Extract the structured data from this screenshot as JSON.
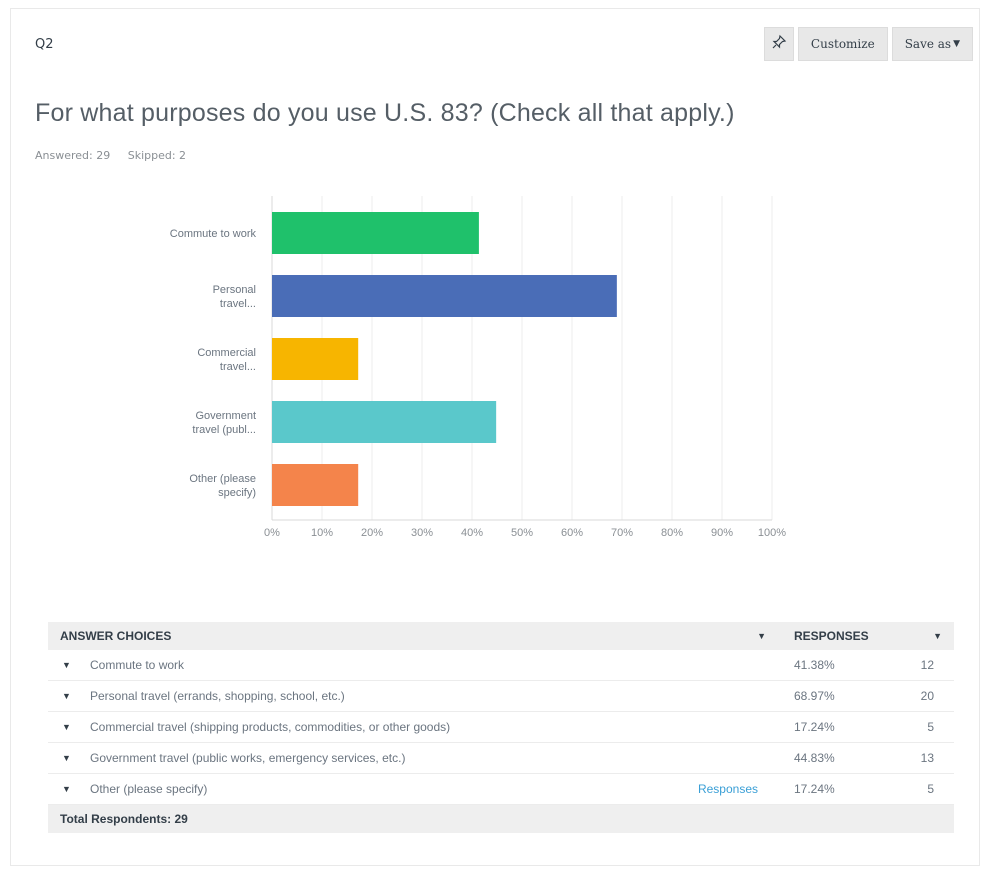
{
  "question": {
    "number": "Q2",
    "title": "For what purposes do you use U.S. 83? (Check all that apply.)",
    "answered": "Answered: 29",
    "skipped": "Skipped: 2"
  },
  "toolbar": {
    "pin_icon": "pin-icon",
    "customize_label": "Customize",
    "save_as_label": "Save as"
  },
  "chart_data": {
    "type": "bar",
    "orientation": "horizontal",
    "categories": [
      [
        "Commute to work"
      ],
      [
        "Personal",
        "travel..."
      ],
      [
        "Commercial",
        "travel..."
      ],
      [
        "Government",
        "travel (publ..."
      ],
      [
        "Other (please",
        "specify)"
      ]
    ],
    "values": [
      41.38,
      68.97,
      17.24,
      44.83,
      17.24
    ],
    "colors": [
      "#1fc16b",
      "#4a6db7",
      "#f7b500",
      "#5ac8cb",
      "#f4844b"
    ],
    "x_ticks": [
      "0%",
      "10%",
      "20%",
      "30%",
      "40%",
      "50%",
      "60%",
      "70%",
      "80%",
      "90%",
      "100%"
    ],
    "xlim": [
      0,
      100
    ],
    "grid": true
  },
  "table": {
    "header_choice": "ANSWER CHOICES",
    "header_responses": "RESPONSES",
    "rows": [
      {
        "choice": "Commute to work",
        "percent": "41.38%",
        "count": "12",
        "link": ""
      },
      {
        "choice": "Personal travel (errands, shopping, school, etc.)",
        "percent": "68.97%",
        "count": "20",
        "link": ""
      },
      {
        "choice": "Commercial travel (shipping products, commodities, or other goods)",
        "percent": "17.24%",
        "count": "5",
        "link": ""
      },
      {
        "choice": "Government travel (public works, emergency services, etc.)",
        "percent": "44.83%",
        "count": "13",
        "link": ""
      },
      {
        "choice": "Other (please specify)",
        "percent": "17.24%",
        "count": "5",
        "link": "Responses"
      }
    ],
    "footer": "Total Respondents: 29"
  }
}
